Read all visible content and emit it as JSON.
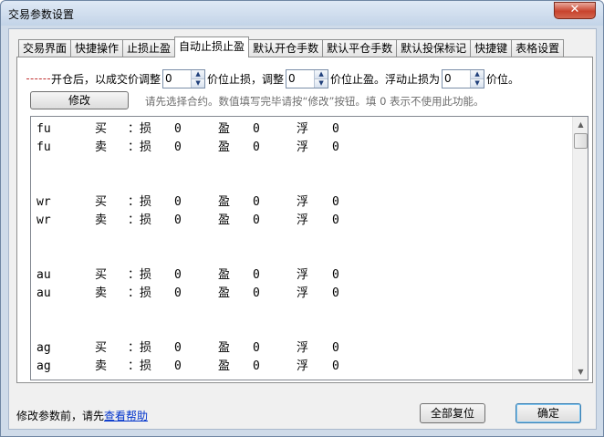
{
  "window": {
    "title": "交易参数设置",
    "close_label": "✕"
  },
  "tabs": [
    {
      "label": "交易界面",
      "active": false
    },
    {
      "label": "快捷操作",
      "active": false
    },
    {
      "label": "止损止盈",
      "active": false
    },
    {
      "label": "自动止损止盈",
      "active": true
    },
    {
      "label": "默认开仓手数",
      "active": false
    },
    {
      "label": "默认平仓手数",
      "active": false
    },
    {
      "label": "默认投保标记",
      "active": false
    },
    {
      "label": "快捷键",
      "active": false
    },
    {
      "label": "表格设置",
      "active": false
    }
  ],
  "settings": {
    "part1": "开仓后，以成交价调整",
    "price_adjust": "0",
    "part2": "价位止损，调整",
    "profit_adjust": "0",
    "part3": "价位止盈。浮动止损为",
    "float_stop": "0",
    "part4": "价位。"
  },
  "modify_button": "修改",
  "hint": "请先选择合约。数值填写完毕请按“修改”按钮。填 0 表示不使用此功能。",
  "list": {
    "rows": [
      {
        "code": "fu",
        "dir": "买",
        "loss_label": "：损",
        "loss": "0",
        "profit_label": "盈",
        "profit": "0",
        "float_label": "浮",
        "float": "0"
      },
      {
        "code": "fu",
        "dir": "卖",
        "loss_label": "：损",
        "loss": "0",
        "profit_label": "盈",
        "profit": "0",
        "float_label": "浮",
        "float": "0"
      },
      {
        "code": "wr",
        "dir": "买",
        "loss_label": "：损",
        "loss": "0",
        "profit_label": "盈",
        "profit": "0",
        "float_label": "浮",
        "float": "0"
      },
      {
        "code": "wr",
        "dir": "卖",
        "loss_label": "：损",
        "loss": "0",
        "profit_label": "盈",
        "profit": "0",
        "float_label": "浮",
        "float": "0"
      },
      {
        "code": "au",
        "dir": "买",
        "loss_label": "：损",
        "loss": "0",
        "profit_label": "盈",
        "profit": "0",
        "float_label": "浮",
        "float": "0"
      },
      {
        "code": "au",
        "dir": "卖",
        "loss_label": "：损",
        "loss": "0",
        "profit_label": "盈",
        "profit": "0",
        "float_label": "浮",
        "float": "0"
      },
      {
        "code": "ag",
        "dir": "买",
        "loss_label": "：损",
        "loss": "0",
        "profit_label": "盈",
        "profit": "0",
        "float_label": "浮",
        "float": "0"
      },
      {
        "code": "ag",
        "dir": "卖",
        "loss_label": "：损",
        "loss": "0",
        "profit_label": "盈",
        "profit": "0",
        "float_label": "浮",
        "float": "0"
      }
    ]
  },
  "footer": {
    "note": "修改参数前，请先",
    "help_link": "查看帮助",
    "reset_button": "全部复位",
    "ok_button": "确定"
  }
}
